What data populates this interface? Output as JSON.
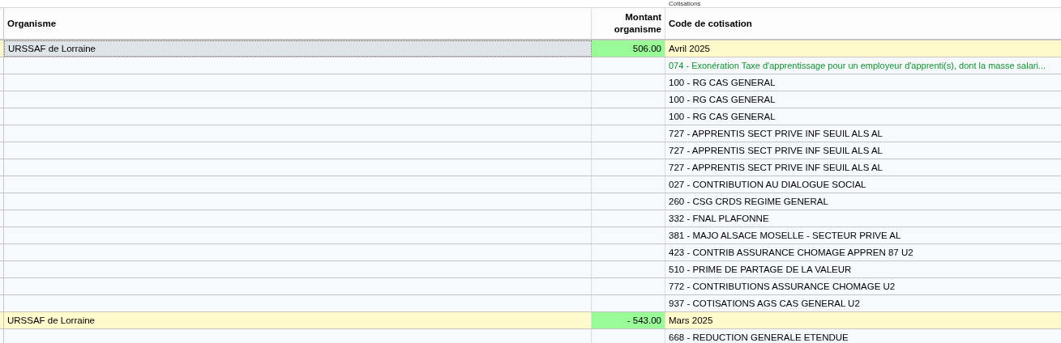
{
  "table": {
    "group_header": "Cotisations",
    "columns": [
      "Organisme",
      "Montant organisme",
      "Code de cotisation"
    ],
    "rows": [
      {
        "kind": "group",
        "organisme": "URSSAF de Lorraine",
        "amount": "506.00",
        "period": "Avril 2025",
        "selected": true
      },
      {
        "kind": "exemption",
        "code": "074 - Exonération Taxe d'apprentissage pour un employeur d'apprenti(s), dont la masse salari..."
      },
      {
        "kind": "code",
        "code": "100 - RG CAS GENERAL"
      },
      {
        "kind": "code",
        "code": "100 - RG CAS GENERAL"
      },
      {
        "kind": "code",
        "code": "100 - RG CAS GENERAL"
      },
      {
        "kind": "code",
        "code": "727 - APPRENTIS SECT PRIVE INF SEUIL ALS AL"
      },
      {
        "kind": "code",
        "code": "727 - APPRENTIS SECT PRIVE INF SEUIL ALS AL"
      },
      {
        "kind": "code",
        "code": "727 - APPRENTIS SECT PRIVE INF SEUIL ALS AL"
      },
      {
        "kind": "code",
        "code": "027 - CONTRIBUTION AU DIALOGUE SOCIAL"
      },
      {
        "kind": "code",
        "code": "260 - CSG CRDS REGIME GENERAL"
      },
      {
        "kind": "code",
        "code": "332 - FNAL PLAFONNE"
      },
      {
        "kind": "code",
        "code": "381 - MAJO ALSACE MOSELLE - SECTEUR PRIVE AL"
      },
      {
        "kind": "code",
        "code": "423 - CONTRIB ASSURANCE CHOMAGE APPREN 87 U2"
      },
      {
        "kind": "code",
        "code": "510 - PRIME DE PARTAGE DE LA VALEUR"
      },
      {
        "kind": "code",
        "code": "772 - CONTRIBUTIONS ASSURANCE CHOMAGE U2"
      },
      {
        "kind": "code",
        "code": "937 - COTISATIONS AGS CAS GENERAL U2"
      },
      {
        "kind": "group",
        "organisme": "URSSAF de Lorraine",
        "amount": "- 543.00",
        "period": "Mars 2025",
        "selected": false
      },
      {
        "kind": "code",
        "code": "668 - REDUCTION GENERALE ETENDUE"
      }
    ]
  }
}
